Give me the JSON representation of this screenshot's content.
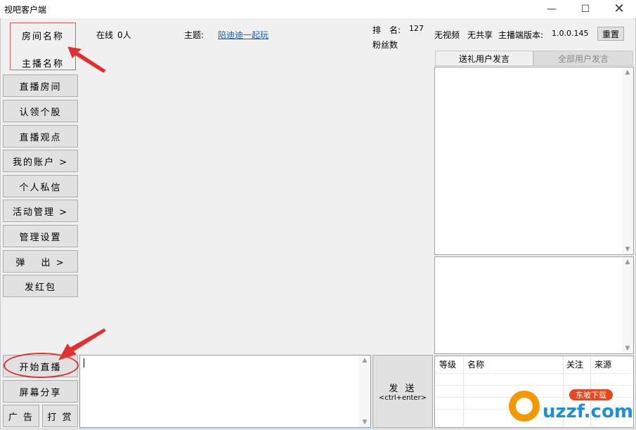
{
  "window": {
    "title": "视吧客户端",
    "minimize_icon": "minimize-icon",
    "maximize_icon": "maximize-icon",
    "close_icon": "close-icon"
  },
  "left_nav": {
    "room_name": "房间名称",
    "host_name": "主播名称",
    "items": [
      "直播房间",
      "认领个股",
      "直播观点",
      "我的账户 >",
      "个人私信",
      "活动管理 >",
      "管理设置",
      "弹　 出 >",
      "发红包"
    ],
    "start_live": "开始直播",
    "screen_share": "屏幕分享",
    "ads": "广 告",
    "reward": "打 赏"
  },
  "header": {
    "online_label": "在线",
    "online_count": "0人",
    "topic_label": "主题:",
    "topic_value": "陪迪迪一起玩",
    "rank_label": "排　名:",
    "rank_value": "127",
    "fans_label": "粉丝数",
    "no_video": "无视频",
    "no_share": "无共享",
    "host_version_label": "主播端版本:",
    "host_version_value": "1.0.0.145",
    "reset_button": "重置"
  },
  "right_panel": {
    "tabs": [
      "送礼用户发言",
      "全部用户发言"
    ],
    "active_tab": 0,
    "user_table_columns": [
      "等级",
      "名称",
      "关注",
      "来源"
    ]
  },
  "compose": {
    "send_label": "发 送",
    "send_shortcut": "<ctrl+enter>"
  },
  "watermark": {
    "text": "uzzf.com",
    "badge": "东坡下载",
    "icon": "d-logo-icon"
  },
  "colors": {
    "annotation_red": "#e03030",
    "link_blue": "#1a5fb4",
    "tab_active_bg": "#f0f0f0",
    "tab_inactive_bg": "#dcdcdc"
  }
}
